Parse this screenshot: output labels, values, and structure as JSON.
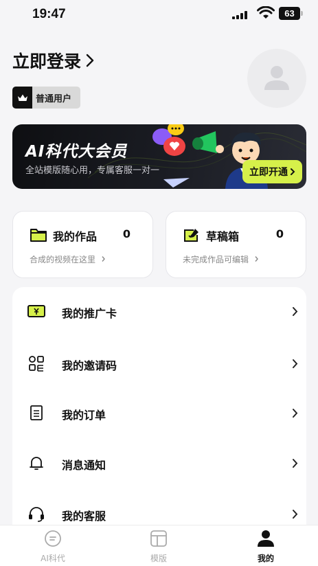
{
  "status_bar": {
    "time": "19:47",
    "battery": "63"
  },
  "header": {
    "login_text": "立即登录",
    "badge_label": "普通用户"
  },
  "banner": {
    "title": "AI科代大会员",
    "subtitle": "全站模版随心用，专属客服一对一",
    "cta_label": "立即开通",
    "accent_color": "#d6f04a"
  },
  "cards": [
    {
      "title": "我的作品",
      "count": "0",
      "subtitle": "合成的视频在这里"
    },
    {
      "title": "草稿箱",
      "count": "0",
      "subtitle": "未完成作品可编辑"
    }
  ],
  "menu": {
    "items": [
      {
        "label": "我的推广卡",
        "icon": "promo-card-icon"
      },
      {
        "label": "我的邀请码",
        "icon": "qr-code-icon"
      },
      {
        "label": "我的订单",
        "icon": "order-icon"
      },
      {
        "label": "消息通知",
        "icon": "bell-icon"
      },
      {
        "label": "我的客服",
        "icon": "headset-icon"
      }
    ]
  },
  "tabbar": {
    "tabs": [
      {
        "label": "AI科代",
        "icon": "chat-icon",
        "active": false
      },
      {
        "label": "模版",
        "icon": "template-icon",
        "active": false
      },
      {
        "label": "我的",
        "icon": "user-icon",
        "active": true
      }
    ]
  }
}
